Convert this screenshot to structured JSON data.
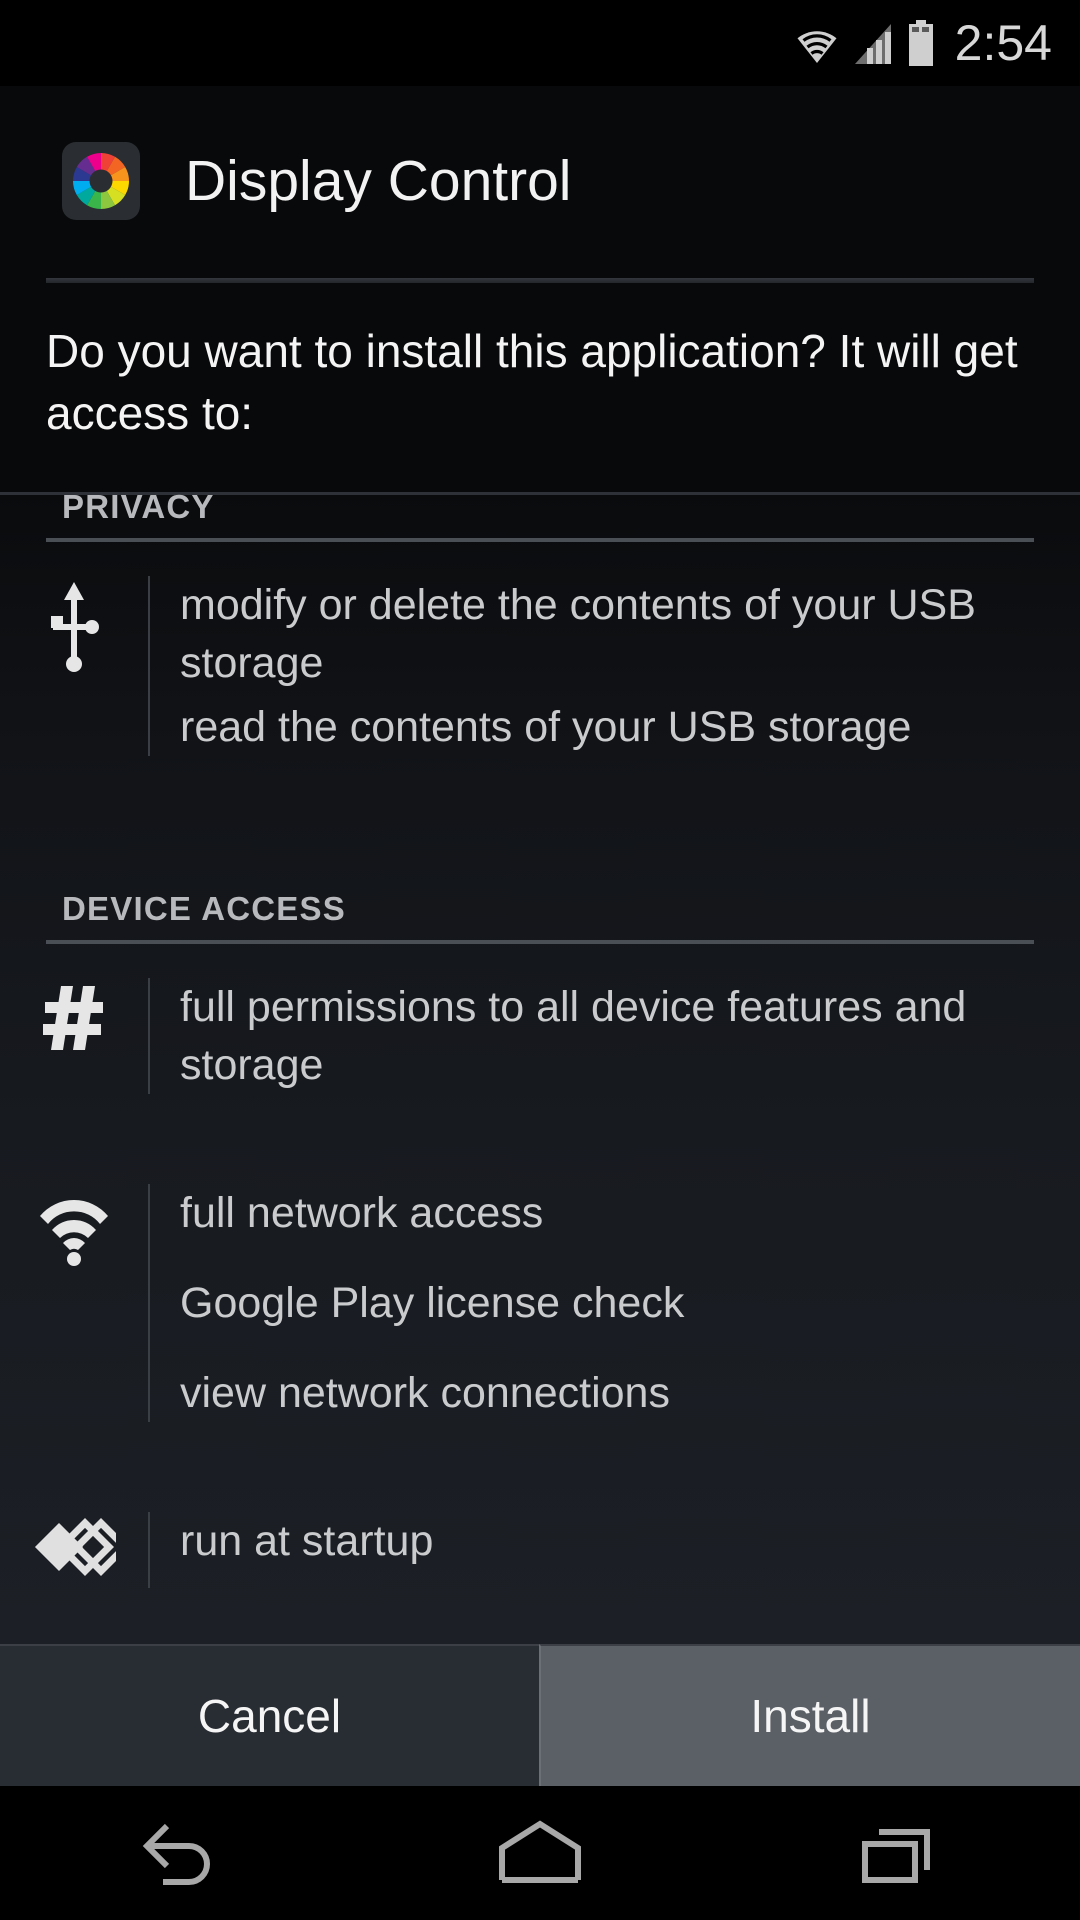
{
  "status_bar": {
    "time": "2:54",
    "icons": [
      "wifi-icon",
      "cellular-signal-icon",
      "battery-icon"
    ]
  },
  "header": {
    "app_name": "Display Control",
    "app_icon": "color-wheel-icon",
    "icon_colors": [
      "#ef4136",
      "#f26522",
      "#f7941e",
      "#fdd700",
      "#d7df23",
      "#8dc63f",
      "#39b54a",
      "#00a99d",
      "#00aeef",
      "#2b3990",
      "#662d91",
      "#ec008c"
    ]
  },
  "prompt": {
    "text": "Do you want to install this application? It will get access to:"
  },
  "permissions": {
    "sections": [
      {
        "title": "PRIVACY",
        "clipped": true,
        "groups": [
          {
            "icon": "usb-icon",
            "lines": [
              "modify or delete the contents of your USB storage",
              "read the contents of your USB storage"
            ]
          }
        ]
      },
      {
        "title": "DEVICE ACCESS",
        "clipped": false,
        "groups": [
          {
            "icon": "hash-icon",
            "lines": [
              "full permissions to all device features and storage"
            ]
          },
          {
            "icon": "wifi-signal-icon",
            "lines": [
              "full network access",
              "Google Play license check",
              "view network connections"
            ]
          },
          {
            "icon": "run-at-startup-icon",
            "lines": [
              "run at startup"
            ]
          }
        ]
      }
    ]
  },
  "buttons": {
    "cancel": "Cancel",
    "install": "Install"
  },
  "navigation": {
    "back": "back-icon",
    "home": "home-icon",
    "recents": "recents-icon"
  },
  "colors": {
    "background": "#08090b",
    "install_button": "#5b6067",
    "cancel_button": "#282c33",
    "primary_text": "#f4f4f4",
    "secondary_text": "#c9cbcd",
    "section_header_text": "#b7b9bc"
  }
}
